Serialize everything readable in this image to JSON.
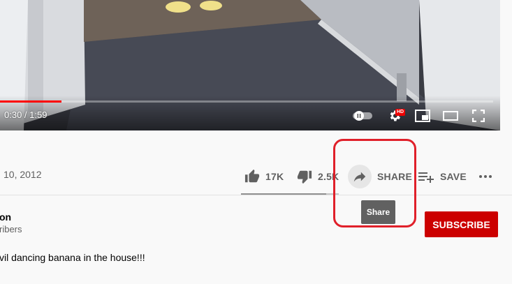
{
  "player": {
    "time": "0:30 / 1:59",
    "progress_fraction": 0.125,
    "hd_badge": "HD",
    "controls": [
      "autoplay-toggle",
      "settings-gear-icon",
      "miniplayer-icon",
      "theater-mode-icon",
      "fullscreen-icon"
    ]
  },
  "video": {
    "date": "10, 2012"
  },
  "actions": {
    "like_count": "17K",
    "dislike_count": "2.5K",
    "share_label": "SHARE",
    "save_label": "SAVE",
    "like_ratio": 0.87
  },
  "tooltip": {
    "text": "Share"
  },
  "channel": {
    "name": "on",
    "subscribers": "ribers",
    "subscribe_label": "SUBSCRIBE"
  },
  "description": {
    "line1": "vil dancing banana in the house!!!",
    "line2": ""
  },
  "colors": {
    "progress": "#ff0000",
    "subscribe_bg": "#cc0000",
    "highlight": "#e0202a",
    "tooltip_bg": "#616161"
  }
}
